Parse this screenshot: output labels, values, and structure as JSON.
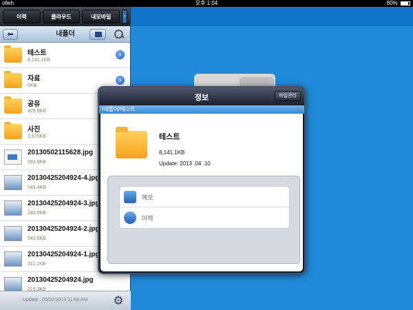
{
  "status": {
    "carrier": "olleh",
    "time": "오후 1:04",
    "battery": "80%",
    "battery_level": 0.8
  },
  "sidebar": {
    "tabs": [
      "이력",
      "클라우드",
      "내모바일"
    ],
    "nav_title": "내폴더",
    "items": [
      {
        "name": "테스트",
        "size": "8,141.1KB",
        "type": "folder",
        "disclosure": true
      },
      {
        "name": "자료",
        "size": "0KB",
        "type": "folder",
        "disclosure": true
      },
      {
        "name": "공유",
        "size": "429.9KB",
        "type": "folder",
        "disclosure": false
      },
      {
        "name": "사진",
        "size": "3,875KB",
        "type": "folder",
        "disclosure": false
      },
      {
        "name": "20130502115628.jpg",
        "size": "593.9KB",
        "type": "doc",
        "disclosure": false
      },
      {
        "name": "20130425204924-4.jpg",
        "size": "543.4KB",
        "type": "image",
        "disclosure": false
      },
      {
        "name": "20130425204924-3.jpg",
        "size": "240.8KB",
        "type": "image",
        "disclosure": false
      },
      {
        "name": "20130425204924-2.jpg",
        "size": "543.5KB",
        "type": "image",
        "disclosure": false
      },
      {
        "name": "20130425204924-1.jpg",
        "size": "311.1KB",
        "type": "image",
        "disclosure": false
      },
      {
        "name": "20130425204924.jpg",
        "size": "215.3KB",
        "type": "image",
        "disclosure": false
      }
    ],
    "footer_update": "Update : 05/02/2013 11:56 AM"
  },
  "modal": {
    "title": "정보",
    "manage_button": "파일관리",
    "path": "/내폴더/테스트",
    "item_name": "테스트",
    "item_size": "8,141.1KB",
    "item_update": "Update: 2013 .04 .10",
    "actions": [
      "메모",
      "이력"
    ]
  },
  "colors": {
    "background": "#1f8bd8",
    "accent": "#1b62c6",
    "folder": "#f5a21c"
  }
}
